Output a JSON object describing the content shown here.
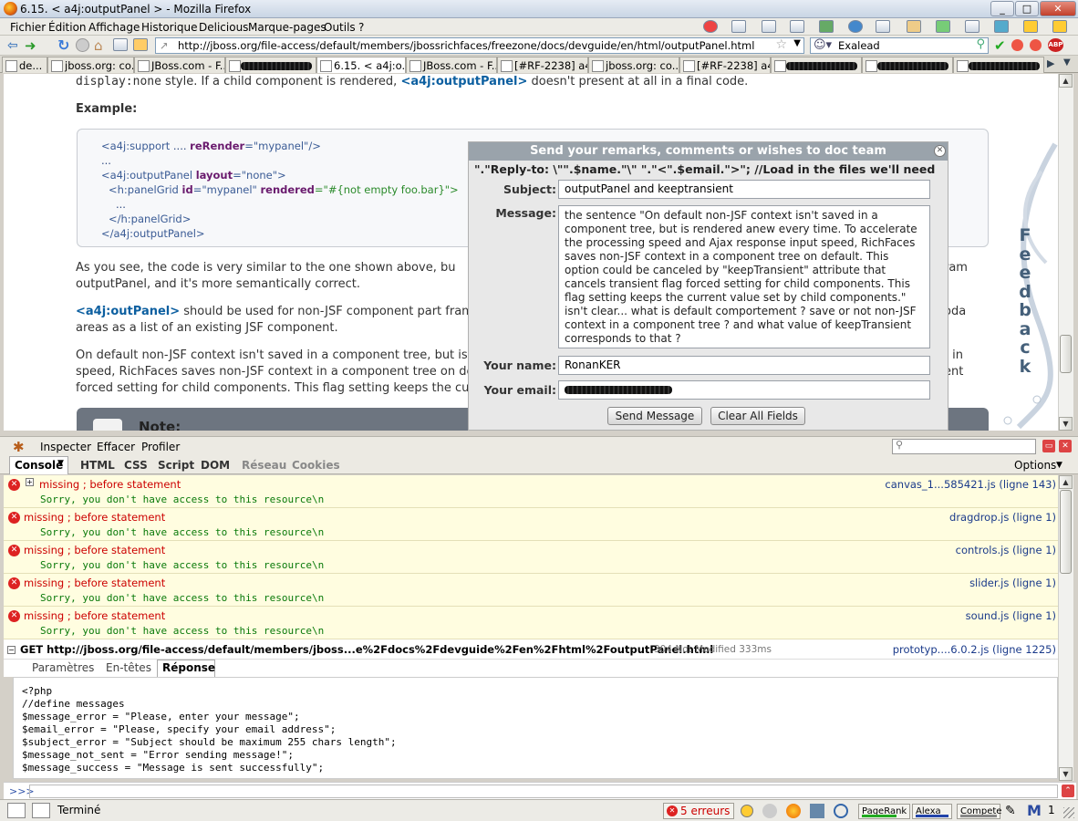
{
  "window": {
    "title": "6.15. < a4j:outputPanel > - Mozilla Firefox"
  },
  "menu": [
    "Fichier",
    "Édition",
    "Affichage",
    "Historique",
    "Delicious",
    "Marque-pages",
    "Outils",
    "?"
  ],
  "nav": {
    "url": "http://jboss.org/file-access/default/members/jbossrichfaces/freezone/docs/devguide/en/html/outputPanel.html",
    "search_engine_value": "Exalead"
  },
  "tabs": [
    "de...",
    "jboss.org: co...",
    "JBoss.com - F...",
    "6.15. < a4j:o...",
    "JBoss.com - F...",
    "[#RF-2238] a4...",
    "jboss.org: co...",
    "[#RF-2238] a4..."
  ],
  "page": {
    "line1_pre": "display:none",
    "line1_mid": " style. If a child component is rendered, ",
    "line1_kw": "<a4j:outputPanel>",
    "line1_post": " doesn't present at all in a final code.",
    "example_heading": "Example:",
    "code": {
      "l1a": "<a4j:support",
      "l1b": " .... ",
      "l1c": "reRender",
      "l1d": "=\"mypanel\"/>",
      "l2": "...",
      "l3a": "<a4j:outputPanel ",
      "l3b": "layout",
      "l3c": "=\"none\">",
      "l4a": "<h:panelGrid ",
      "l4b": "id",
      "l4c": "=\"mypanel\" ",
      "l4d": "rendered",
      "l4e": "=\"#{not empty foo.bar}\">",
      "l5": "...",
      "l6": "</h:panelGrid>",
      "l7": "</a4j:outputPanel>"
    },
    "p1_line1": "As you see, the code is very similar to the one shown above, bu",
    "p1_tail1": "ram",
    "p1_line2": "outputPanel, and it's more semantically correct.",
    "p2_kw": "<a4j:outPanel>",
    "p2_line1": " should be used for non-JSF component part frami",
    "p2_tail1": "oda",
    "p2_line2": "areas as a list of an existing JSF component.",
    "p3_line1": "On default non-JSF context isn't saved in a component tree, but is",
    "p3_tail1": "e in",
    "p3_line2": "speed, RichFaces saves non-JSF context in a component tree on def",
    "p3_tail2": "ent",
    "p3_line3": "forced setting for child components. This flag setting keeps the curre",
    "note": "Note:"
  },
  "dialog": {
    "title": "Send your remarks, comments or wishes to doc team",
    "php_leak": "\".\"Reply-to: \\\"\".$name.\"\\\" \".\"<\".$email.\">\"; //Load in the files we'll need",
    "subject_label": "Subject:",
    "subject_value": "outputPanel and keeptransient",
    "message_label": "Message:",
    "message_value": " the sentence \"On default non-JSF context isn't saved in a component tree, but is rendered anew every time. To accelerate the processing speed and Ajax response input speed, RichFaces saves non-JSF context in a component tree on default. This option could be canceled by \"keepTransient\"  attribute that cancels transient flag forced setting for child components. This flag setting keeps the current value set by child components.\" isn't clear... what is default comportement ? save or not non-JSF context in a component tree ? and what value of keepTransient corresponds to that ?",
    "name_label": "Your name:",
    "name_value": "RonanKER",
    "email_label": "Your email:",
    "send_button": "Send Message",
    "clear_button": "Clear All Fields"
  },
  "feedback_tab": "Feedback",
  "firebug": {
    "toolbar": [
      "Inspecter",
      "Effacer",
      "Profiler"
    ],
    "tabs": [
      "Console",
      "HTML",
      "CSS",
      "Script",
      "DOM",
      "Réseau",
      "Cookies"
    ],
    "options": "Options",
    "errors": [
      {
        "msg": "missing ; before statement",
        "src": "canvas_1...585421.js (ligne 143)",
        "detail": "Sorry, you don't have access to this resource\\n"
      },
      {
        "msg": "missing ; before statement",
        "src": "dragdrop.js (ligne 1)",
        "detail": "Sorry, you don't have access to this resource\\n"
      },
      {
        "msg": "missing ; before statement",
        "src": "controls.js (ligne 1)",
        "detail": "Sorry, you don't have access to this resource\\n"
      },
      {
        "msg": "missing ; before statement",
        "src": "slider.js (ligne 1)",
        "detail": "Sorry, you don't have access to this resource\\n"
      },
      {
        "msg": "missing ; before statement",
        "src": "sound.js (ligne 1)",
        "detail": "Sorry, you don't have access to this resource\\n"
      }
    ],
    "net": {
      "request": "GET http://jboss.org/file-access/default/members/jboss...e%2Fdocs%2Fdevguide%2Fen%2Fhtml%2FoutputPanel.html",
      "status": "304 Not Modified 333ms",
      "src": "prototyp....6.0.2.js (ligne 1225)",
      "subtabs": [
        "Paramètres",
        "En-têtes",
        "Réponse"
      ]
    },
    "response_lines": [
      "<?php",
      "//define messages",
      "$message_error = \"Please, enter your message\";",
      "$email_error = \"Please, specify your email address\";",
      "$subject_error = \"Subject should be maximum 255 chars length\";",
      "$message_not_sent = \"Error sending message!\";",
      "$message_success = \"Message is sent successfully\";"
    ],
    "cmd_prompt": ">>>"
  },
  "status": {
    "text": "Terminé",
    "errors": "5 erreurs",
    "pagerank": "PageRank",
    "alexa": "Alexa",
    "compete": "Compete",
    "count": "1"
  }
}
